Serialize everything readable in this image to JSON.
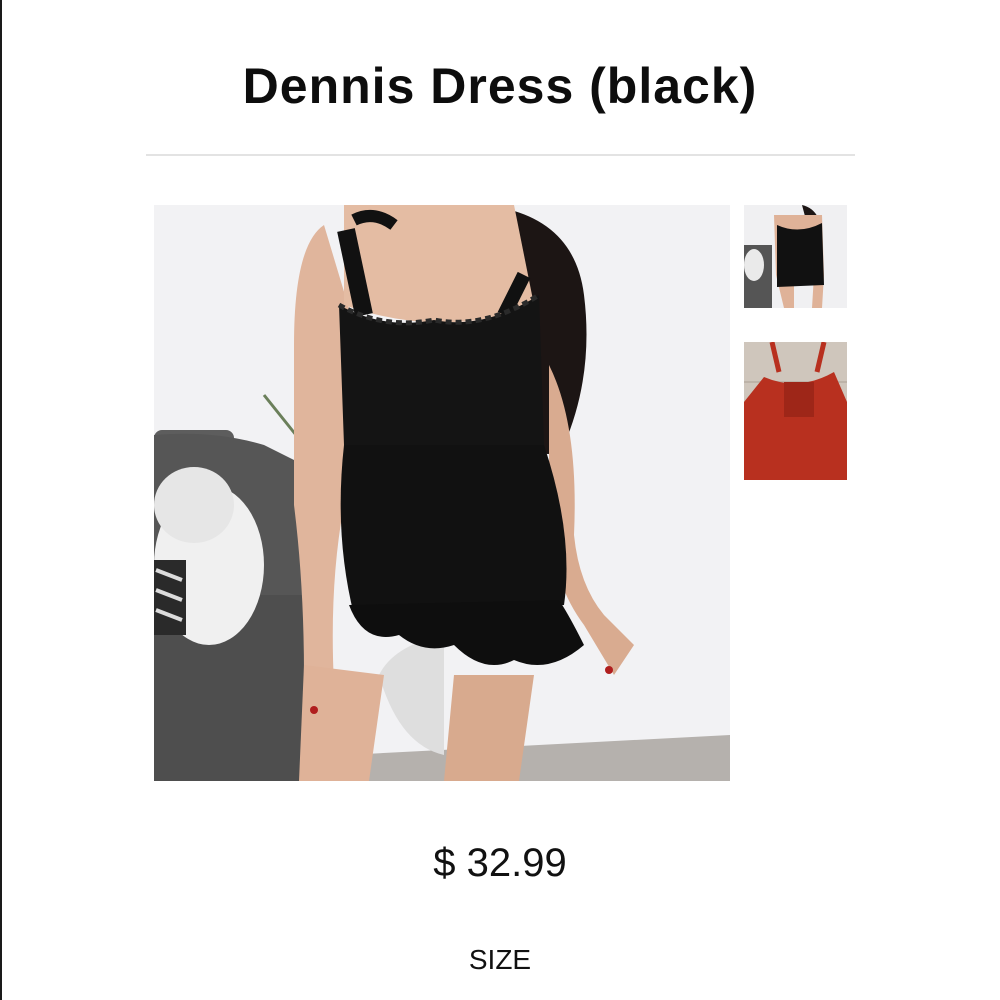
{
  "product": {
    "title": "Dennis Dress (black)",
    "price": "$ 32.99",
    "size_label": "SIZE"
  },
  "gallery": {
    "main_image": {
      "subject": "model wearing black ruffle mini dress",
      "selected": true
    },
    "thumbnails": [
      {
        "subject": "black dress front view"
      },
      {
        "subject": "red dress back view"
      }
    ]
  },
  "colors": {
    "dress_black": "#111111",
    "dress_red": "#b8301f",
    "divider": "#e3e3e3",
    "background": "#ffffff"
  }
}
